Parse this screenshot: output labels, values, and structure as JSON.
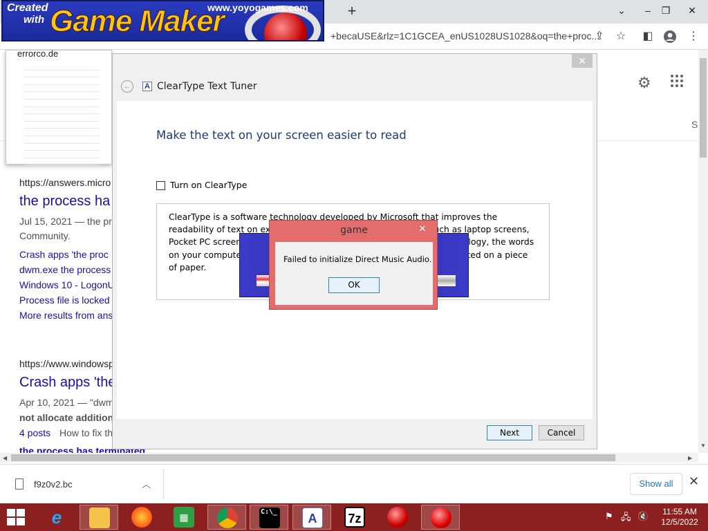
{
  "browser": {
    "url_fragment": "+becaUSE&rlz=1C1GCEA_enUS1028US1028&oq=the+proc...",
    "new_tab_glyph": "+",
    "window_controls": [
      "⌄",
      "–",
      "❐",
      "✕"
    ]
  },
  "banner": {
    "created": "Created",
    "with": "with",
    "title": "Game Maker",
    "url": "www.yoyogames.com"
  },
  "preview": {
    "site": "errorco.de"
  },
  "google": {
    "right_edge_letter": "S",
    "results": [
      {
        "cite": "https://answers.micro",
        "title": "the process ha",
        "snippet_date": "Jul 15, 2021 — the pr",
        "snippet_tail": "Community.",
        "links": [
          "Crash apps 'the proc",
          "dwm.exe the process",
          "Windows 10 - LogonU",
          "Process file is locked",
          "More results from ans"
        ]
      },
      {
        "cite": "https://www.windowsp",
        "title": "Crash apps 'the",
        "snippet_date": "Apr 10, 2021 — \"dwm",
        "snippet_bold": "not allocate addition",
        "posts": "4 posts",
        "posts_tail": "How to fix th",
        "next_title": "the process has terminated ..."
      }
    ]
  },
  "cleartype": {
    "title": "ClearType Text Tuner",
    "heading": "Make the text on your screen easier to read",
    "checkbox_label": "Turn on ClearType",
    "description": "ClearType is a software technology developed by Microsoft that improves the readability of text on existing LCDs (Liquid Crystal Displays), such as laptop screens, Pocket PC screens and flat panel monitors. With ClearType font technology, the words on your computer screen look almost as sharp and clear as those printed on a piece of paper.",
    "next_label": "Next",
    "cancel_label": "Cancel"
  },
  "game_dialog": {
    "title": "game",
    "message": "Failed to initialize Direct Music Audio.",
    "ok_label": "OK"
  },
  "downloads": {
    "filename": "f9z0v2.bc",
    "show_all_label": "Show all"
  },
  "taskbar": {
    "items": [
      "internet-explorer",
      "file-explorer",
      "firefox",
      "store",
      "chrome",
      "cmd",
      "cleartype",
      "7zip",
      "gamemaker-red",
      "game-active"
    ],
    "time": "11:55 AM",
    "date": "12/5/2022",
    "colors": {
      "taskbar": "#8c1f1f",
      "dialog_frame": "#e36d6d",
      "link": "#1a0dab"
    }
  }
}
